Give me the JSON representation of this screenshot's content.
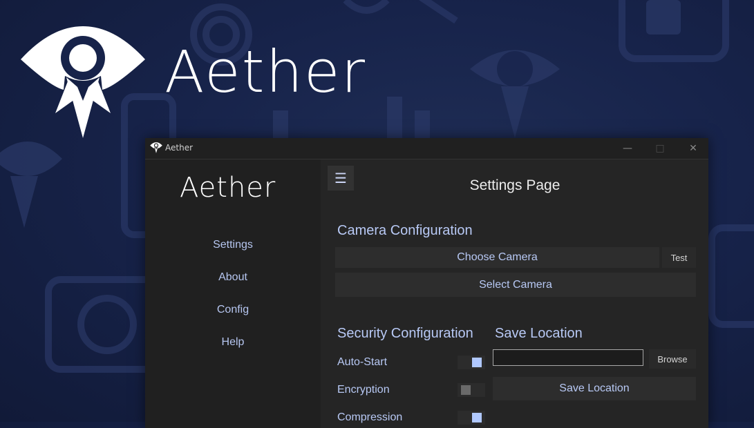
{
  "hero": {
    "title": "Aether"
  },
  "window": {
    "title": "Aether",
    "controls": {
      "minimize": "—",
      "maximize": "□",
      "close": "✕"
    }
  },
  "sidebar": {
    "logo": "Aether",
    "items": [
      {
        "label": "Settings"
      },
      {
        "label": "About"
      },
      {
        "label": "Config"
      },
      {
        "label": "Help"
      }
    ]
  },
  "main": {
    "menu_icon": "☰",
    "page_title": "Settings Page",
    "camera": {
      "heading": "Camera Configuration",
      "choose_label": "Choose Camera",
      "test_label": "Test",
      "select_label": "Select Camera"
    },
    "security": {
      "heading": "Security Configuration",
      "options": [
        {
          "label": "Auto-Start",
          "state": "on"
        },
        {
          "label": "Encryption",
          "state": "off"
        },
        {
          "label": "Compression",
          "state": "on"
        }
      ]
    },
    "save": {
      "heading": "Save Location",
      "path_value": "",
      "browse_label": "Browse",
      "save_label": "Save Location"
    }
  },
  "colors": {
    "accent": "#b8c9f5",
    "toggle_on": "#b0c8ff",
    "background": "#17234a",
    "panel": "#252525",
    "sidebar": "#202020"
  },
  "icons": [
    "aether-logo-icon",
    "hamburger-menu-icon",
    "minimize-icon",
    "maximize-icon",
    "close-icon"
  ]
}
